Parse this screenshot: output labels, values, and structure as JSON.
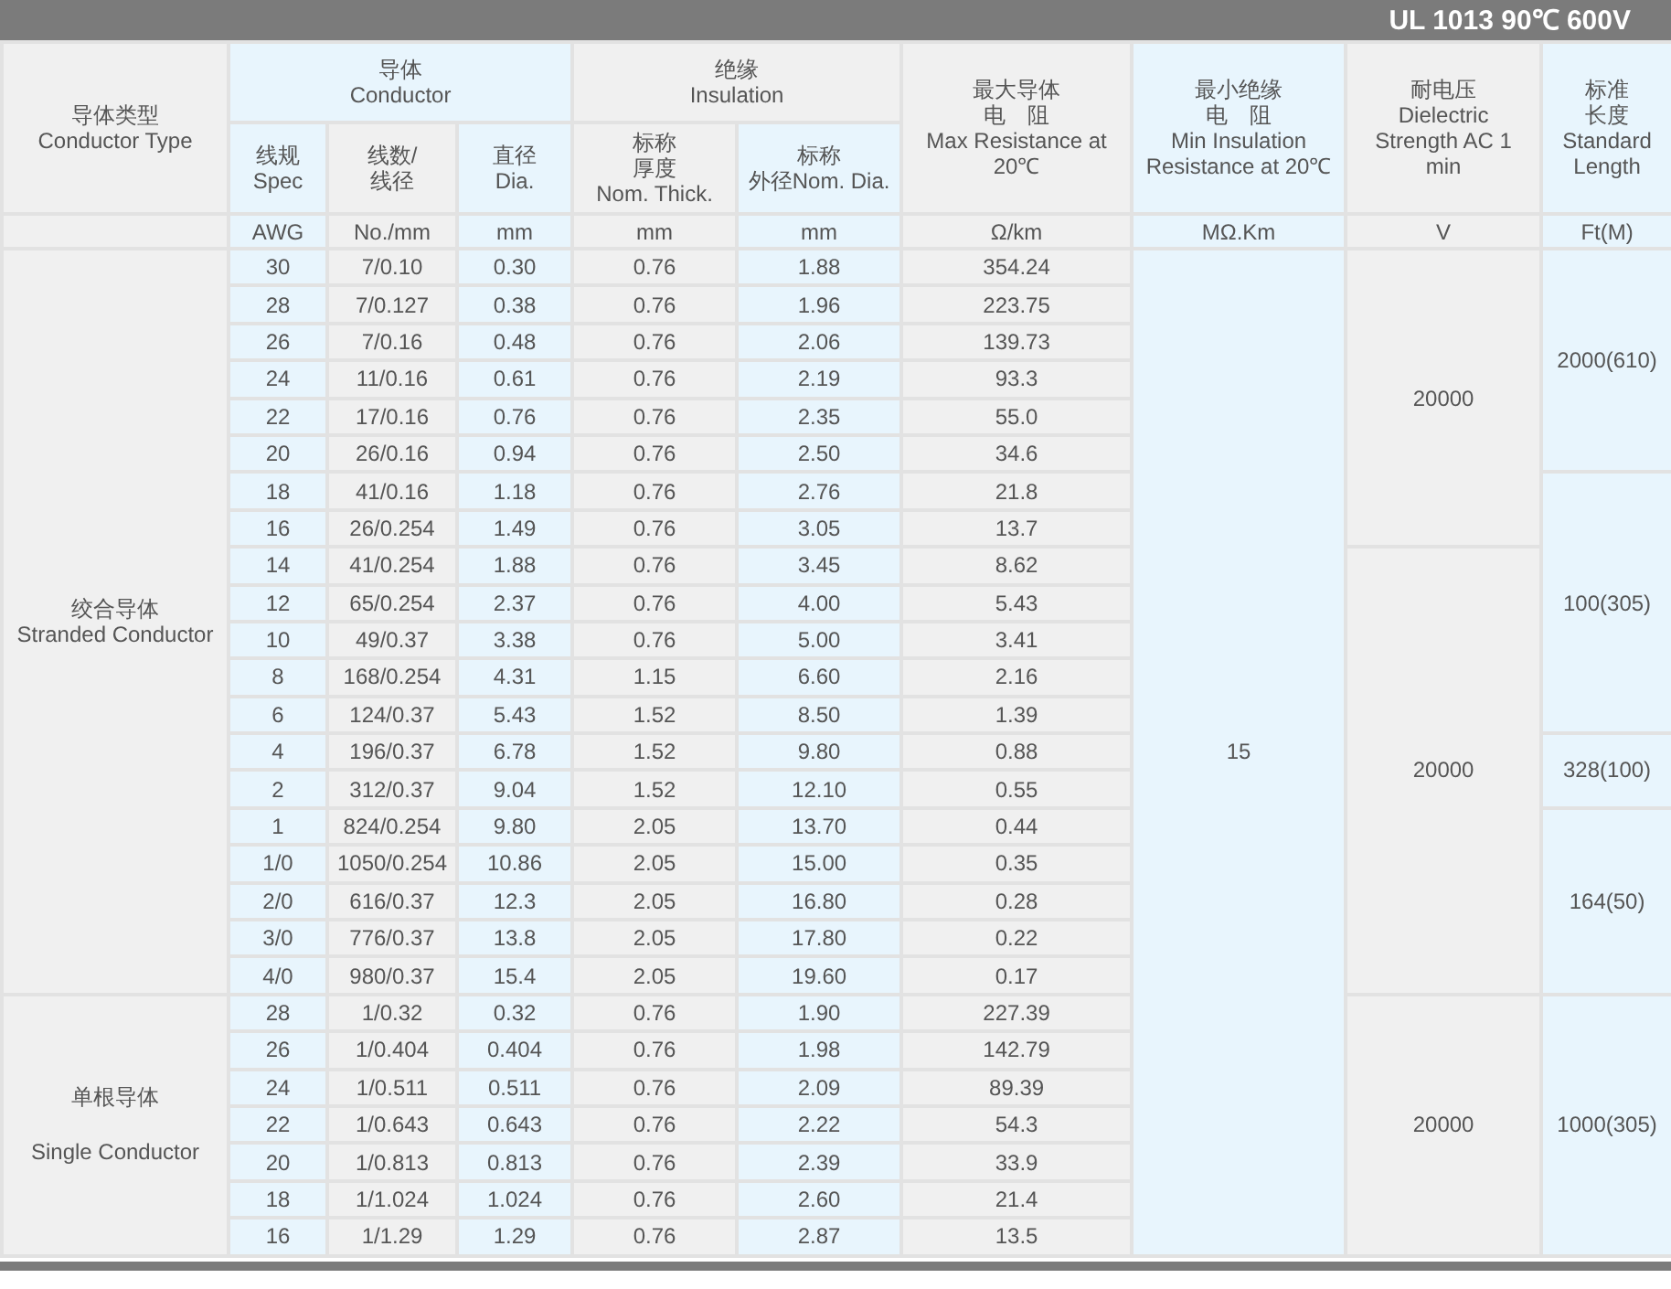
{
  "title": "UL 1013 90℃ 600V",
  "headers": {
    "conductor_type": [
      "导体类型",
      "Conductor Type"
    ],
    "conductor": [
      "导体",
      "Conductor"
    ],
    "insulation": [
      "绝缘",
      "Insulation"
    ],
    "max_resistance": [
      "最大导体",
      "电　阻",
      "Max Resistance at",
      "20℃"
    ],
    "min_insulation": [
      "最小绝缘",
      "电　阻",
      "Min Insulation",
      "Resistance at 20℃"
    ],
    "dielectric": [
      "耐电压",
      "Dielectric",
      "Strength AC 1",
      "min"
    ],
    "length": [
      "标准",
      "长度",
      "Standard",
      "Length"
    ],
    "spec": [
      "线规",
      "Spec"
    ],
    "strands": [
      "线数/",
      "线径"
    ],
    "diameter": [
      "直径",
      "Dia."
    ],
    "thickness": [
      "标称",
      "厚度",
      "Nom. Thick."
    ],
    "outer_dia": [
      "标称",
      "外径Nom. Dia."
    ]
  },
  "units": [
    "AWG",
    "No./mm",
    "mm",
    "mm",
    "mm",
    "Ω/km",
    "MΩ.Km",
    "V",
    "Ft(M)"
  ],
  "rows": [
    {
      "conductor_type": [
        "绞合导体",
        "Stranded Conductor"
      ],
      "spec": "30",
      "strands": "7/0.10",
      "dia": "0.30",
      "thick": "0.76",
      "od": "1.88",
      "resistance": "354.24",
      "insulation_resistance": "15",
      "dielectric": "20000",
      "length": "2000(610)"
    },
    {
      "spec": "28",
      "strands": "7/0.127",
      "dia": "0.38",
      "thick": "0.76",
      "od": "1.96",
      "resistance": "223.75"
    },
    {
      "spec": "26",
      "strands": "7/0.16",
      "dia": "0.48",
      "thick": "0.76",
      "od": "2.06",
      "resistance": "139.73"
    },
    {
      "spec": "24",
      "strands": "11/0.16",
      "dia": "0.61",
      "thick": "0.76",
      "od": "2.19",
      "resistance": "93.3"
    },
    {
      "spec": "22",
      "strands": "17/0.16",
      "dia": "0.76",
      "thick": "0.76",
      "od": "2.35",
      "resistance": "55.0"
    },
    {
      "spec": "20",
      "strands": "26/0.16",
      "dia": "0.94",
      "thick": "0.76",
      "od": "2.50",
      "resistance": "34.6"
    },
    {
      "spec": "18",
      "strands": "41/0.16",
      "dia": "1.18",
      "thick": "0.76",
      "od": "2.76",
      "resistance": "21.8",
      "length": "100(305)"
    },
    {
      "spec": "16",
      "strands": "26/0.254",
      "dia": "1.49",
      "thick": "0.76",
      "od": "3.05",
      "resistance": "13.7"
    },
    {
      "spec": "14",
      "strands": "41/0.254",
      "dia": "1.88",
      "thick": "0.76",
      "od": "3.45",
      "resistance": "8.62",
      "dielectric": "20000"
    },
    {
      "spec": "12",
      "strands": "65/0.254",
      "dia": "2.37",
      "thick": "0.76",
      "od": "4.00",
      "resistance": "5.43"
    },
    {
      "spec": "10",
      "strands": "49/0.37",
      "dia": "3.38",
      "thick": "0.76",
      "od": "5.00",
      "resistance": "3.41"
    },
    {
      "spec": "8",
      "strands": "168/0.254",
      "dia": "4.31",
      "thick": "1.15",
      "od": "6.60",
      "resistance": "2.16"
    },
    {
      "spec": "6",
      "strands": "124/0.37",
      "dia": "5.43",
      "thick": "1.52",
      "od": "8.50",
      "resistance": "1.39"
    },
    {
      "spec": "4",
      "strands": "196/0.37",
      "dia": "6.78",
      "thick": "1.52",
      "od": "9.80",
      "resistance": "0.88",
      "length": "328(100)"
    },
    {
      "spec": "2",
      "strands": "312/0.37",
      "dia": "9.04",
      "thick": "1.52",
      "od": "12.10",
      "resistance": "0.55"
    },
    {
      "spec": "1",
      "strands": "824/0.254",
      "dia": "9.80",
      "thick": "2.05",
      "od": "13.70",
      "resistance": "0.44",
      "length": "164(50)"
    },
    {
      "spec": "1/0",
      "strands": "1050/0.254",
      "dia": "10.86",
      "thick": "2.05",
      "od": "15.00",
      "resistance": "0.35"
    },
    {
      "spec": "2/0",
      "strands": "616/0.37",
      "dia": "12.3",
      "thick": "2.05",
      "od": "16.80",
      "resistance": "0.28"
    },
    {
      "spec": "3/0",
      "strands": "776/0.37",
      "dia": "13.8",
      "thick": "2.05",
      "od": "17.80",
      "resistance": "0.22"
    },
    {
      "spec": "4/0",
      "strands": "980/0.37",
      "dia": "15.4",
      "thick": "2.05",
      "od": "19.60",
      "resistance": "0.17"
    },
    {
      "conductor_type": [
        "单根导体",
        "Single Conductor"
      ],
      "spec": "28",
      "strands": "1/0.32",
      "dia": "0.32",
      "thick": "0.76",
      "od": "1.90",
      "resistance": "227.39",
      "dielectric": "20000",
      "length": "1000(305)"
    },
    {
      "spec": "26",
      "strands": "1/0.404",
      "dia": "0.404",
      "thick": "0.76",
      "od": "1.98",
      "resistance": "142.79"
    },
    {
      "spec": "24",
      "strands": "1/0.511",
      "dia": "0.511",
      "thick": "0.76",
      "od": "2.09",
      "resistance": "89.39"
    },
    {
      "spec": "22",
      "strands": "1/0.643",
      "dia": "0.643",
      "thick": "0.76",
      "od": "2.22",
      "resistance": "54.3"
    },
    {
      "spec": "20",
      "strands": "1/0.813",
      "dia": "0.813",
      "thick": "0.76",
      "od": "2.39",
      "resistance": "33.9"
    },
    {
      "spec": "18",
      "strands": "1/1.024",
      "dia": "1.024",
      "thick": "0.76",
      "od": "2.60",
      "resistance": "21.4"
    },
    {
      "spec": "16",
      "strands": "1/1.29",
      "dia": "1.29",
      "thick": "0.76",
      "od": "2.87",
      "resistance": "13.5"
    }
  ]
}
